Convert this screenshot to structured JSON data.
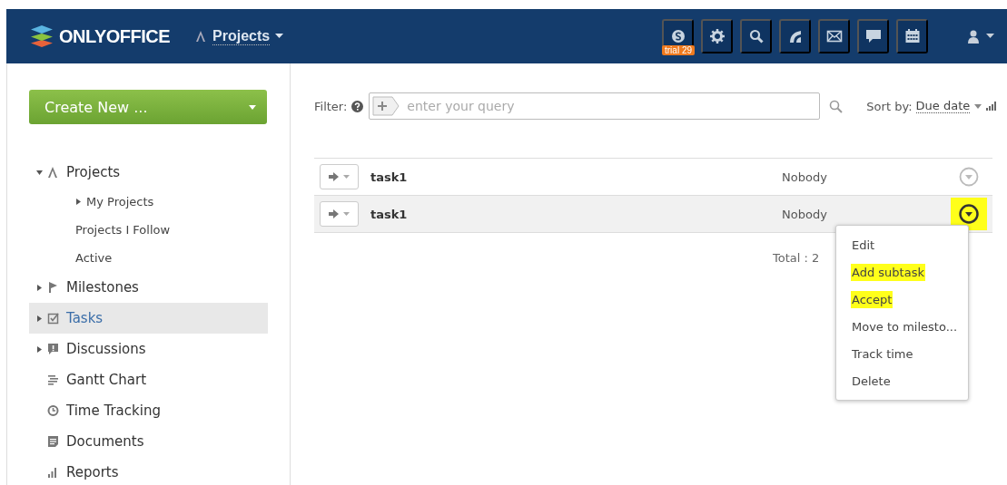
{
  "header": {
    "logo": "ONLYOFFICE",
    "module": "Projects",
    "trial_badge": "trial 29"
  },
  "sidebar": {
    "create_button": "Create New ...",
    "items": [
      {
        "label": "Projects",
        "expanded": true,
        "selected": false,
        "children": [
          {
            "label": "My Projects",
            "expanded": false
          },
          {
            "label": "Projects I Follow"
          },
          {
            "label": "Active"
          }
        ]
      },
      {
        "label": "Milestones",
        "expanded": false,
        "selected": false
      },
      {
        "label": "Tasks",
        "expanded": false,
        "selected": true
      },
      {
        "label": "Discussions",
        "expanded": false,
        "selected": false
      },
      {
        "label": "Gantt Chart",
        "selected": false
      },
      {
        "label": "Time Tracking",
        "selected": false
      },
      {
        "label": "Documents",
        "selected": false
      },
      {
        "label": "Reports",
        "selected": false
      }
    ]
  },
  "filter": {
    "label": "Filter:",
    "placeholder": "enter your query",
    "sort_label": "Sort by:",
    "sort_value": "Due date"
  },
  "tasks": [
    {
      "title": "task1",
      "responsible": "Nobody",
      "selected": false,
      "highlighted": false
    },
    {
      "title": "task1",
      "responsible": "Nobody",
      "selected": true,
      "highlighted": true
    }
  ],
  "total": "Total : 2",
  "context_menu": [
    {
      "label": "Edit",
      "highlighted": false
    },
    {
      "label": "Add subtask",
      "highlighted": true
    },
    {
      "label": "Accept",
      "highlighted": true
    },
    {
      "label": "Move to milesto...",
      "highlighted": false
    },
    {
      "label": "Track time",
      "highlighted": false
    },
    {
      "label": "Delete",
      "highlighted": false
    }
  ]
}
